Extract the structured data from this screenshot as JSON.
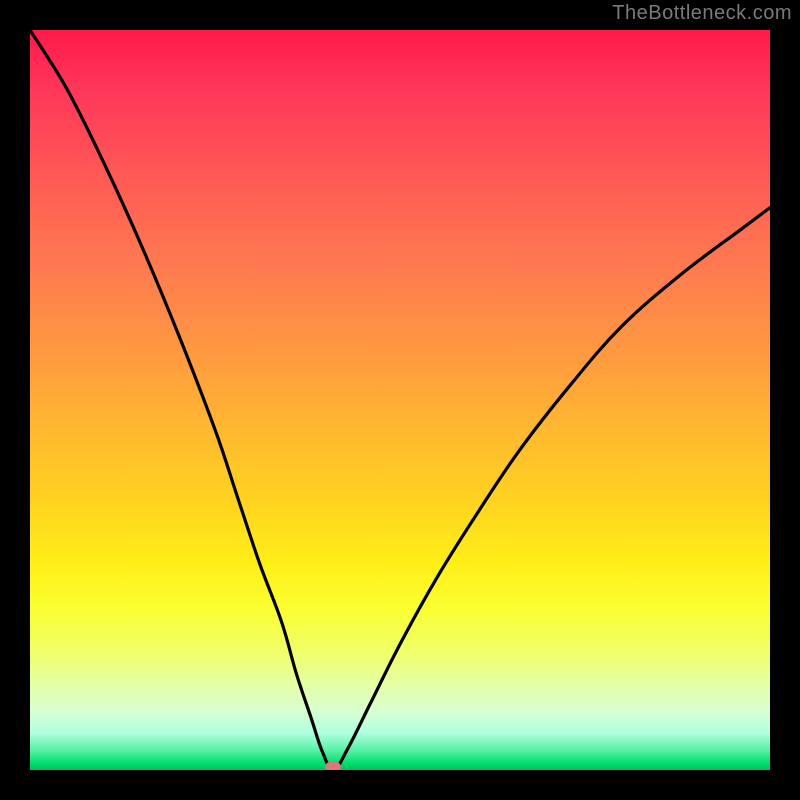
{
  "watermark": "TheBottleneck.com",
  "chart_data": {
    "type": "line",
    "title": "",
    "xlabel": "",
    "ylabel": "",
    "x_range": [
      0,
      100
    ],
    "y_range": [
      0,
      100
    ],
    "grid": false,
    "legend": false,
    "background_gradient": {
      "top_color": "#ff1a4a",
      "mid_color": "#ffd420",
      "bottom_color": "#00c060"
    },
    "marker": {
      "x": 41,
      "y": 0,
      "color": "#d87a7a"
    },
    "series": [
      {
        "name": "bottleneck-curve",
        "x": [
          0,
          5,
          10,
          15,
          20,
          25,
          28,
          31,
          34,
          36,
          38,
          39.5,
          41,
          43,
          46,
          50,
          55,
          60,
          66,
          73,
          80,
          88,
          96,
          100
        ],
        "y": [
          100,
          92,
          82,
          71,
          59,
          46,
          37,
          28,
          20,
          13,
          7,
          2.5,
          0,
          3,
          9,
          17,
          26,
          34,
          43,
          52,
          60,
          67,
          73,
          76
        ]
      }
    ]
  }
}
